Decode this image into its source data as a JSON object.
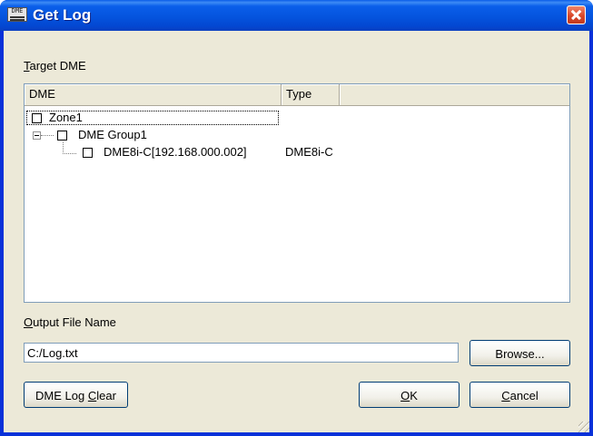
{
  "window": {
    "title": "Get Log",
    "icon": "dme-app-icon",
    "icon_text": "DME",
    "close_icon": "close-icon"
  },
  "target_dme": {
    "label_accel": "T",
    "label_rest": "arget DME"
  },
  "list": {
    "columns": [
      "DME",
      "Type"
    ],
    "rows": [
      {
        "label": "Zone1",
        "type": "",
        "level": 0,
        "checked": false
      },
      {
        "label": "DME Group1",
        "type": "",
        "level": 1,
        "checked": false,
        "expanded": true
      },
      {
        "label": "DME8i-C[192.168.000.002]",
        "type": "DME8i-C",
        "level": 2,
        "checked": false
      }
    ]
  },
  "output": {
    "label_accel": "O",
    "label_rest": "utput File Name",
    "value": "C:/Log.txt"
  },
  "buttons": {
    "browse": "Browse...",
    "clear_pre": "DME Log ",
    "clear_accel": "C",
    "clear_post": "lear",
    "ok_accel": "O",
    "ok_rest": "K",
    "cancel_accel": "C",
    "cancel_rest": "ancel"
  }
}
